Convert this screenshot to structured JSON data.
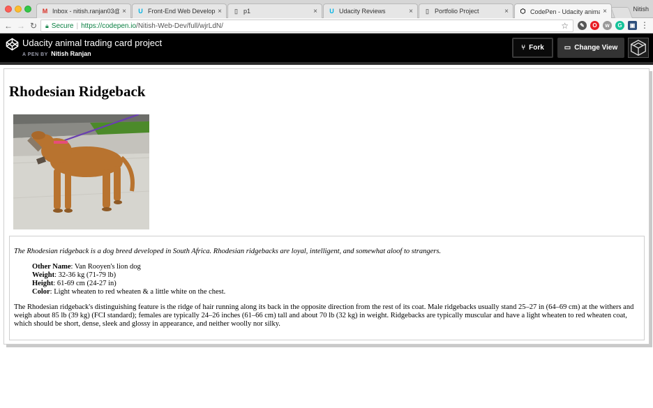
{
  "browser": {
    "tabs": [
      {
        "title": "Inbox - nitish.ranjan03@gm",
        "icon": "gmail-icon",
        "active": false
      },
      {
        "title": "Front-End Web Developer N",
        "icon": "udacity-icon",
        "active": false
      },
      {
        "title": "p1",
        "icon": "document-icon",
        "active": false
      },
      {
        "title": "Udacity Reviews",
        "icon": "udacity-icon",
        "active": false
      },
      {
        "title": "Portfolio Project",
        "icon": "document-icon",
        "active": false
      },
      {
        "title": "CodePen - Udacity animal t",
        "icon": "codepen-icon",
        "active": true
      }
    ],
    "profile_name": "Nitish",
    "secure_label": "Secure",
    "url_scheme_host": "https://codepen.io",
    "url_path": "/Nitish-Web-Dev/full/wjrLdN/"
  },
  "codepen": {
    "title": "Udacity animal trading card project",
    "by_label": "A PEN BY",
    "author": "Nitish Ranjan",
    "fork_label": "Fork",
    "change_view_label": "Change View"
  },
  "card": {
    "title": "Rhodesian Ridgeback",
    "intro": "The Rhodesian ridgeback is a dog breed developed in South Africa. Rhodesian ridgebacks are loyal, intelligent, and somewhat aloof to strangers.",
    "facts": [
      {
        "label": "Other Name",
        "value": ": Van Rooyen's lion dog"
      },
      {
        "label": "Weight",
        "value": ": 32-36 kg (71-79 lb)"
      },
      {
        "label": "Height",
        "value": ": 61-69 cm (24-27 in)"
      },
      {
        "label": "Color",
        "value": ": Light wheaten to red wheaten & a little white on the chest."
      }
    ],
    "description": "The Rhodesian ridgeback's distinguishing feature is the ridge of hair running along its back in the opposite direction from the rest of its coat. Male ridgebacks usually stand 25–27 in (64–69 cm) at the withers and weigh about 85 lb (39 kg) (FCI standard); females are typically 24–26 inches (61–66 cm) tall and about 70 lb (32 kg) in weight. Ridgebacks are typically muscular and have a light wheaten to red wheaten coat, which should be short, dense, sleek and glossy in appearance, and neither woolly nor silky."
  },
  "colors": {
    "codepen_header": "#000000",
    "secure_green": "#0b8043"
  }
}
